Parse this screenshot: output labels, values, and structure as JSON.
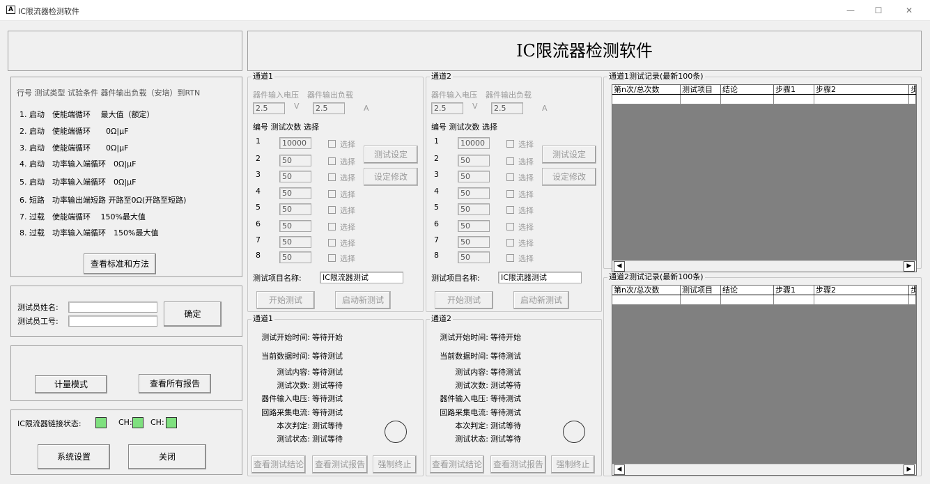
{
  "window": {
    "title": "IC限流器检测软件",
    "icon_text": "A",
    "minimize": "—",
    "maximize": "☐",
    "close": "✕"
  },
  "app_title": "IC限流器检测软件",
  "standards": {
    "header": "行号 测试类型 试验条件 器件输出负载（安培）到RTN",
    "rows": [
      "1. 启动　使能端循环　 最大值（额定）",
      "2. 启动　使能端循环　　0Ω|μF",
      "3. 启动　使能端循环　　0Ω|μF",
      "4. 启动　功率输入端循环　0Ω|μF",
      "5. 启动　功率输入端循环　0Ω|μF",
      "6. 短路　功率输出端短路 开路至0Ω(开路至短路)",
      "7. 过载　使能端循环　 150%最大值",
      "8. 过载　功率输入端循环　150%最大值"
    ],
    "view_button": "查看标准和方法"
  },
  "tester": {
    "name_label": "测试员姓名:",
    "id_label": "测试员工号:",
    "name_value": "",
    "id_value": "",
    "confirm": "确定"
  },
  "modes": {
    "metering": "计量模式",
    "all_reports": "查看所有报告"
  },
  "link": {
    "label": "IC限流器链接状态:",
    "ch1": "CH:",
    "ch2": "CH:",
    "led_color": "#7fe07f"
  },
  "bottom_buttons": {
    "settings": "系统设置",
    "close": "关闭"
  },
  "channels": [
    {
      "title": "通道1",
      "in_v_label": "器件输入电压",
      "out_load_label": "器件输出负载",
      "in_v": "2.5",
      "v_unit": "V",
      "out_load": "2.5",
      "a_unit": "A",
      "col_headers": "编号 测试次数  选择",
      "rows": [
        {
          "no": "1",
          "count": "10000",
          "sel": "选择"
        },
        {
          "no": "2",
          "count": "50",
          "sel": "选择"
        },
        {
          "no": "3",
          "count": "50",
          "sel": "选择"
        },
        {
          "no": "4",
          "count": "50",
          "sel": "选择"
        },
        {
          "no": "5",
          "count": "50",
          "sel": "选择"
        },
        {
          "no": "6",
          "count": "50",
          "sel": "选择"
        },
        {
          "no": "7",
          "count": "50",
          "sel": "选择"
        },
        {
          "no": "8",
          "count": "50",
          "sel": "选择"
        }
      ],
      "test_setting": "测试设定",
      "modify_setting": "设定修改",
      "item_name_label": "测试项目名称:",
      "item_name": "IC限流器测试",
      "start": "开始测试",
      "new_test": "启动新测试",
      "status": {
        "title": "通道1",
        "start_time_label": "测试开始时间:",
        "start_time": "等待开始",
        "data_time_label": "当前数据时间:",
        "data_time": "等待测试",
        "content_label": "测试内容:",
        "content": "等待测试",
        "times_label": "测试次数:",
        "times": "测试等待",
        "in_v_label": "器件输入电压:",
        "in_v": "等待测试",
        "loop_label": "回路采集电流:",
        "loop": "等待测试",
        "judge_label": "本次判定:",
        "judge": "测试等待",
        "state_label": "测试状态:",
        "state": "测试等待"
      },
      "view_result": "查看测试结论",
      "view_report": "查看测试报告",
      "force_stop": "强制终止"
    },
    {
      "title": "通道2",
      "in_v_label": "器件输入电压",
      "out_load_label": "器件输出负载",
      "in_v": "2.5",
      "v_unit": "V",
      "out_load": "2.5",
      "a_unit": "A",
      "col_headers": "编号 测试次数  选择",
      "rows": [
        {
          "no": "1",
          "count": "10000",
          "sel": "选择"
        },
        {
          "no": "2",
          "count": "50",
          "sel": "选择"
        },
        {
          "no": "3",
          "count": "50",
          "sel": "选择"
        },
        {
          "no": "4",
          "count": "50",
          "sel": "选择"
        },
        {
          "no": "5",
          "count": "50",
          "sel": "选择"
        },
        {
          "no": "6",
          "count": "50",
          "sel": "选择"
        },
        {
          "no": "7",
          "count": "50",
          "sel": "选择"
        },
        {
          "no": "8",
          "count": "50",
          "sel": "选择"
        }
      ],
      "test_setting": "测试设定",
      "modify_setting": "设定修改",
      "item_name_label": "测试项目名称:",
      "item_name": "IC限流器测试",
      "start": "开始测试",
      "new_test": "启动新测试",
      "status": {
        "title": "通道2",
        "start_time_label": "测试开始时间:",
        "start_time": "等待开始",
        "data_time_label": "当前数据时间:",
        "data_time": "等待测试",
        "content_label": "测试内容:",
        "content": "等待测试",
        "times_label": "测试次数:",
        "times": "测试等待",
        "in_v_label": "器件输入电压:",
        "in_v": "等待测试",
        "loop_label": "回路采集电流:",
        "loop": "等待测试",
        "judge_label": "本次判定:",
        "judge": "测试等待",
        "state_label": "测试状态:",
        "state": "测试等待"
      },
      "view_result": "查看测试结论",
      "view_report": "查看测试报告",
      "force_stop": "强制终止"
    }
  ],
  "records": [
    {
      "title": "通道1测试记录(最新100条)",
      "columns": [
        "第n次/总次数",
        "测试项目",
        "结论",
        "步骤1",
        "步骤2",
        "步"
      ]
    },
    {
      "title": "通道2测试记录(最新100条)",
      "columns": [
        "第n次/总次数",
        "测试项目",
        "结论",
        "步骤1",
        "步骤2",
        "步"
      ]
    }
  ],
  "scroll": {
    "left": "◀",
    "right": "▶"
  }
}
